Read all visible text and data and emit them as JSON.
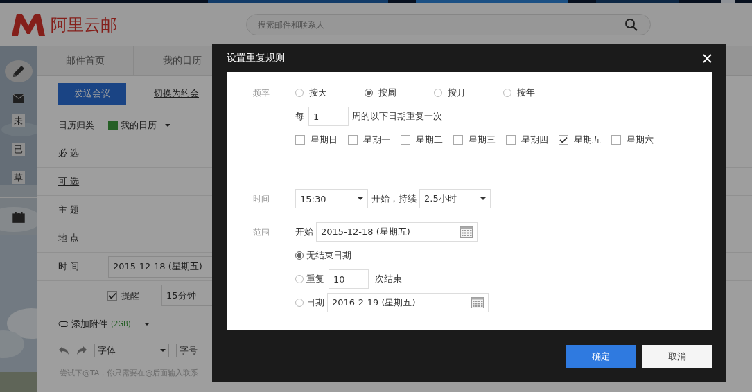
{
  "app": {
    "logo": "阿里云邮",
    "search": {
      "placeholder": "搜索邮件和联系人"
    }
  },
  "nav_badges": [
    "未",
    "已",
    "草"
  ],
  "tabs": [
    "邮件首页",
    "我的日历"
  ],
  "toolbar": {
    "send_button": "发送会议",
    "switch_link": "切换为约会"
  },
  "form": {
    "calendar_label": "日历归类",
    "calendar": "我的日历",
    "rows": [
      {
        "kind": "link",
        "label": "必 选"
      },
      {
        "kind": "link",
        "label": "可 选"
      },
      {
        "kind": "field",
        "label": "主 题"
      },
      {
        "kind": "field",
        "label": "地 点"
      },
      {
        "kind": "date",
        "label": "时 间",
        "value": "2015-12-18 (星期五)"
      }
    ],
    "reminder": {
      "checked": true,
      "label": "提醒",
      "value": "15分钟"
    },
    "attachment": {
      "label": "添加附件",
      "size": "(2GB)"
    },
    "editor": {
      "font": "字体",
      "size": "字号",
      "placeholder": "尝试下@TA，你只需要在@后面输入联系"
    }
  },
  "dialog": {
    "title": "设置重复规则",
    "frequency_label": "频率",
    "frequency": [
      {
        "label": "按天",
        "selected": false
      },
      {
        "label": "按周",
        "selected": true
      },
      {
        "label": "按月",
        "selected": false
      },
      {
        "label": "按年",
        "selected": false
      }
    ],
    "every": {
      "prefix": "每",
      "value": "1",
      "suffix": "周的以下日期重复一次"
    },
    "days": [
      {
        "label": "星期日",
        "checked": false
      },
      {
        "label": "星期一",
        "checked": false
      },
      {
        "label": "星期二",
        "checked": false
      },
      {
        "label": "星期三",
        "checked": false
      },
      {
        "label": "星期四",
        "checked": false
      },
      {
        "label": "星期五",
        "checked": true
      },
      {
        "label": "星期六",
        "checked": false
      }
    ],
    "time_label": "时间",
    "start_time": "15:30",
    "start_suffix": "开始，持续",
    "duration": "2.5小时",
    "range_label": "范围",
    "range_start_label": "开始",
    "range_start": "2015-12-18 (星期五)",
    "end_options": [
      {
        "kind": "none",
        "label": "无结束日期",
        "selected": true
      },
      {
        "kind": "count",
        "label": "重复",
        "value": "10",
        "suffix": "次结束",
        "selected": false
      },
      {
        "kind": "date",
        "label": "日期",
        "value": "2016-2-19 (星期五)",
        "selected": false
      }
    ],
    "confirm": "确定",
    "cancel": "取消"
  }
}
